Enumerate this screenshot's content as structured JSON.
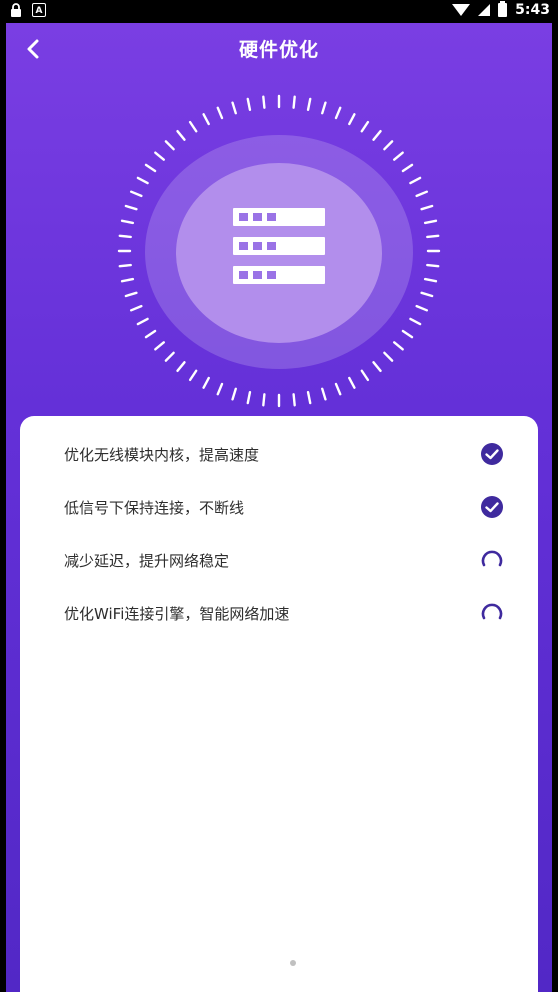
{
  "status_bar": {
    "time": "5:43",
    "left_icons": [
      "lock-icon",
      "a-letter-icon"
    ],
    "left_a_glyph": "A",
    "right_icons": [
      "wifi-icon",
      "cell-signal-icon",
      "battery-icon"
    ]
  },
  "header": {
    "title": "硬件优化",
    "back_icon": "chevron-left-icon"
  },
  "hero": {
    "icon": "server-stack-icon",
    "colors": {
      "ring": "#b28eec",
      "tick": "#ffffff"
    }
  },
  "tasks": [
    {
      "label": "优化无线模块内核，提高速度",
      "status": "done",
      "icon": "check-circle-icon"
    },
    {
      "label": "低信号下保持连接，不断线",
      "status": "done",
      "icon": "check-circle-icon"
    },
    {
      "label": "减少延迟，提升网络稳定",
      "status": "in-progress",
      "icon": "spinner-icon"
    },
    {
      "label": "优化WiFi连接引擎，智能网络加速",
      "status": "in-progress",
      "icon": "spinner-icon"
    }
  ],
  "colors": {
    "accent": "#3f2a9e",
    "gradient_top": "#7a3ee3",
    "gradient_bottom": "#5228c6",
    "card_bg": "#ffffff"
  }
}
